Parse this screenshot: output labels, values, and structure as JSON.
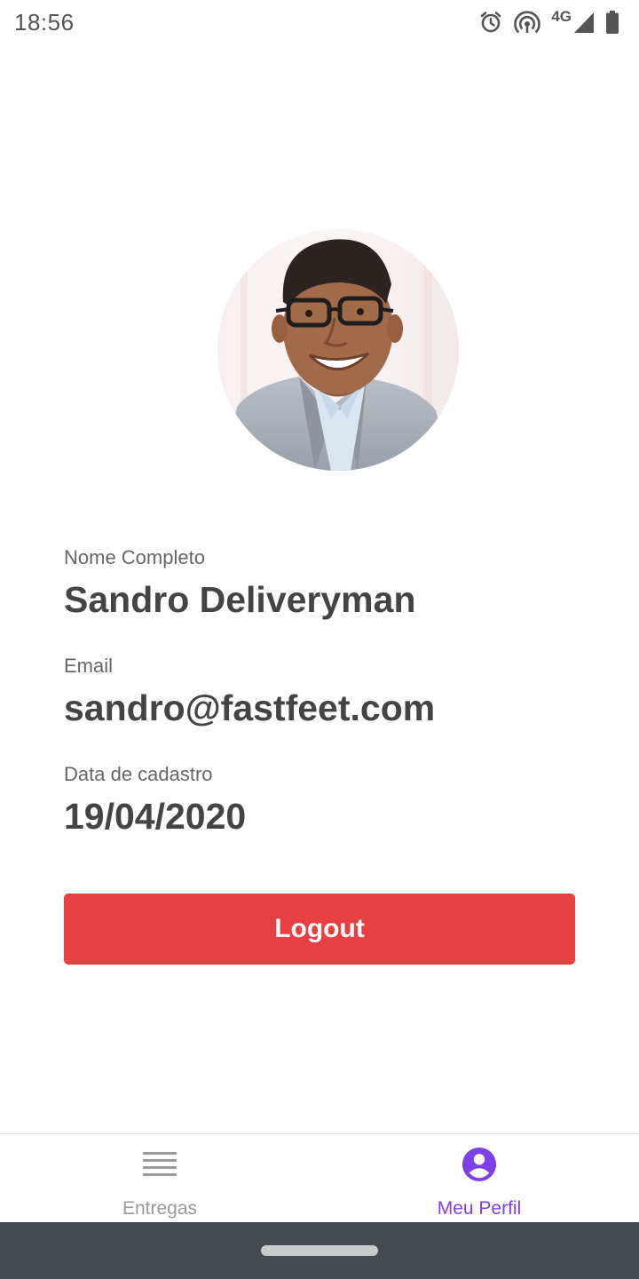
{
  "status_bar": {
    "time": "18:56",
    "network_type": "4G",
    "icons": [
      "alarm-icon",
      "hotspot-icon",
      "signal-icon",
      "battery-icon"
    ]
  },
  "profile": {
    "avatar": "profile-photo",
    "fields": [
      {
        "label": "Nome Completo",
        "value": "Sandro Deliveryman"
      },
      {
        "label": "Email",
        "value": "sandro@fastfeet.com"
      },
      {
        "label": "Data de cadastro",
        "value": "19/04/2020"
      }
    ],
    "logout_label": "Logout"
  },
  "tabs": [
    {
      "label": "Entregas",
      "icon": "list-icon",
      "active": false
    },
    {
      "label": "Meu Perfil",
      "icon": "account-circle-icon",
      "active": true
    }
  ],
  "colors": {
    "accent": "#7d40e7",
    "danger": "#e74042",
    "inactive_tab": "#999999",
    "text_dark": "#444444",
    "nav_bar": "#464b52"
  }
}
